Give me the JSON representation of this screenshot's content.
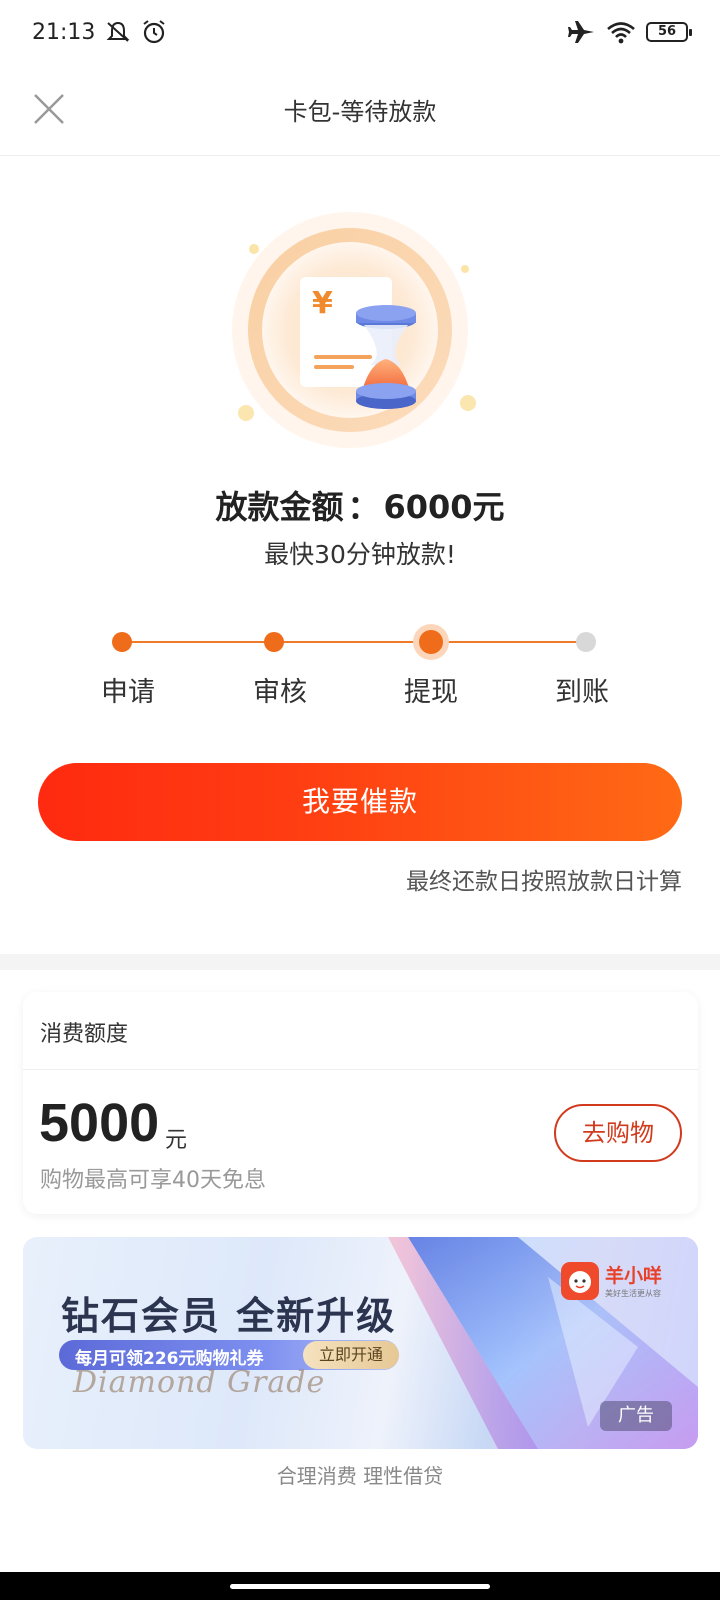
{
  "status_bar": {
    "time": "21:13",
    "battery": "56",
    "icons": [
      "mute-bell-icon",
      "alarm-icon",
      "airplane-icon",
      "wifi-icon",
      "battery-icon"
    ]
  },
  "header": {
    "title": "卡包-等待放款",
    "close_icon": "close-icon"
  },
  "hero": {
    "amount_label": "放款金额",
    "amount_separator": "：",
    "amount_value": "6000元",
    "subtitle": "最快30分钟放款!"
  },
  "progress": {
    "steps": [
      {
        "label": "申请",
        "state": "done"
      },
      {
        "label": "审核",
        "state": "done"
      },
      {
        "label": "提现",
        "state": "current"
      },
      {
        "label": "到账",
        "state": "pending"
      }
    ],
    "colors": {
      "done": "#ef6c1a",
      "pending": "#d8d8d8"
    }
  },
  "cta": {
    "label": "我要催款",
    "note": "最终还款日按照放款日计算"
  },
  "credit": {
    "title": "消费额度",
    "amount": "5000",
    "unit": "元",
    "note": "购物最高可享40天免息",
    "shop_button": "去购物"
  },
  "ad": {
    "headline": "钻石会员  全新升级",
    "pill_text": "每月可领226元购物礼券",
    "open_button": "立即开通",
    "script_text": "Diamond Grade",
    "brand_name": "羊小咩",
    "brand_sub": "美好生活更从容",
    "tag": "广告"
  },
  "footer": {
    "slogan": "合理消费 理性借贷"
  }
}
